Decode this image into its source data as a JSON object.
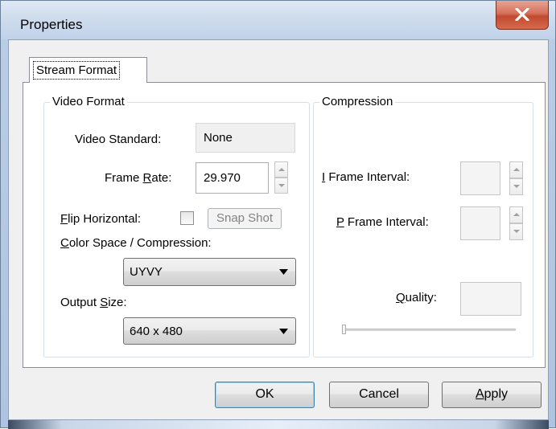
{
  "window": {
    "title": "Properties"
  },
  "tabs": [
    {
      "label": "Stream Format",
      "active": true
    }
  ],
  "video_format": {
    "group_title": "Video Format",
    "video_standard_label": "Video Standard:",
    "video_standard_value": "None",
    "frame_rate_label_pre": "Frame ",
    "frame_rate_label_key": "R",
    "frame_rate_label_post": "ate:",
    "frame_rate_value": "29.970",
    "flip_horizontal_label_key": "F",
    "flip_horizontal_label_post": "lip Horizontal:",
    "flip_horizontal_checked": false,
    "snap_shot_label": "Snap Shot",
    "color_space_label_key": "C",
    "color_space_label_post": "olor Space / Compression:",
    "color_space_value": "UYVY",
    "output_size_label_pre": "Output ",
    "output_size_label_key": "S",
    "output_size_label_post": "ize:",
    "output_size_value": "640 x 480"
  },
  "compression": {
    "group_title": "Compression",
    "i_frame_label_key": "I",
    "i_frame_label_post": " Frame Interval:",
    "p_frame_label_key": "P",
    "p_frame_label_post": " Frame Interval:",
    "quality_label_key": "Q",
    "quality_label_post": "uality:",
    "quality_slider_value": 0
  },
  "buttons": {
    "ok": "OK",
    "cancel": "Cancel",
    "apply_key": "A",
    "apply_post": "pply"
  },
  "icons": {
    "close": "close-icon",
    "spin_up": "spin-up-icon",
    "spin_down": "spin-down-icon",
    "dropdown": "chevron-down-icon"
  }
}
